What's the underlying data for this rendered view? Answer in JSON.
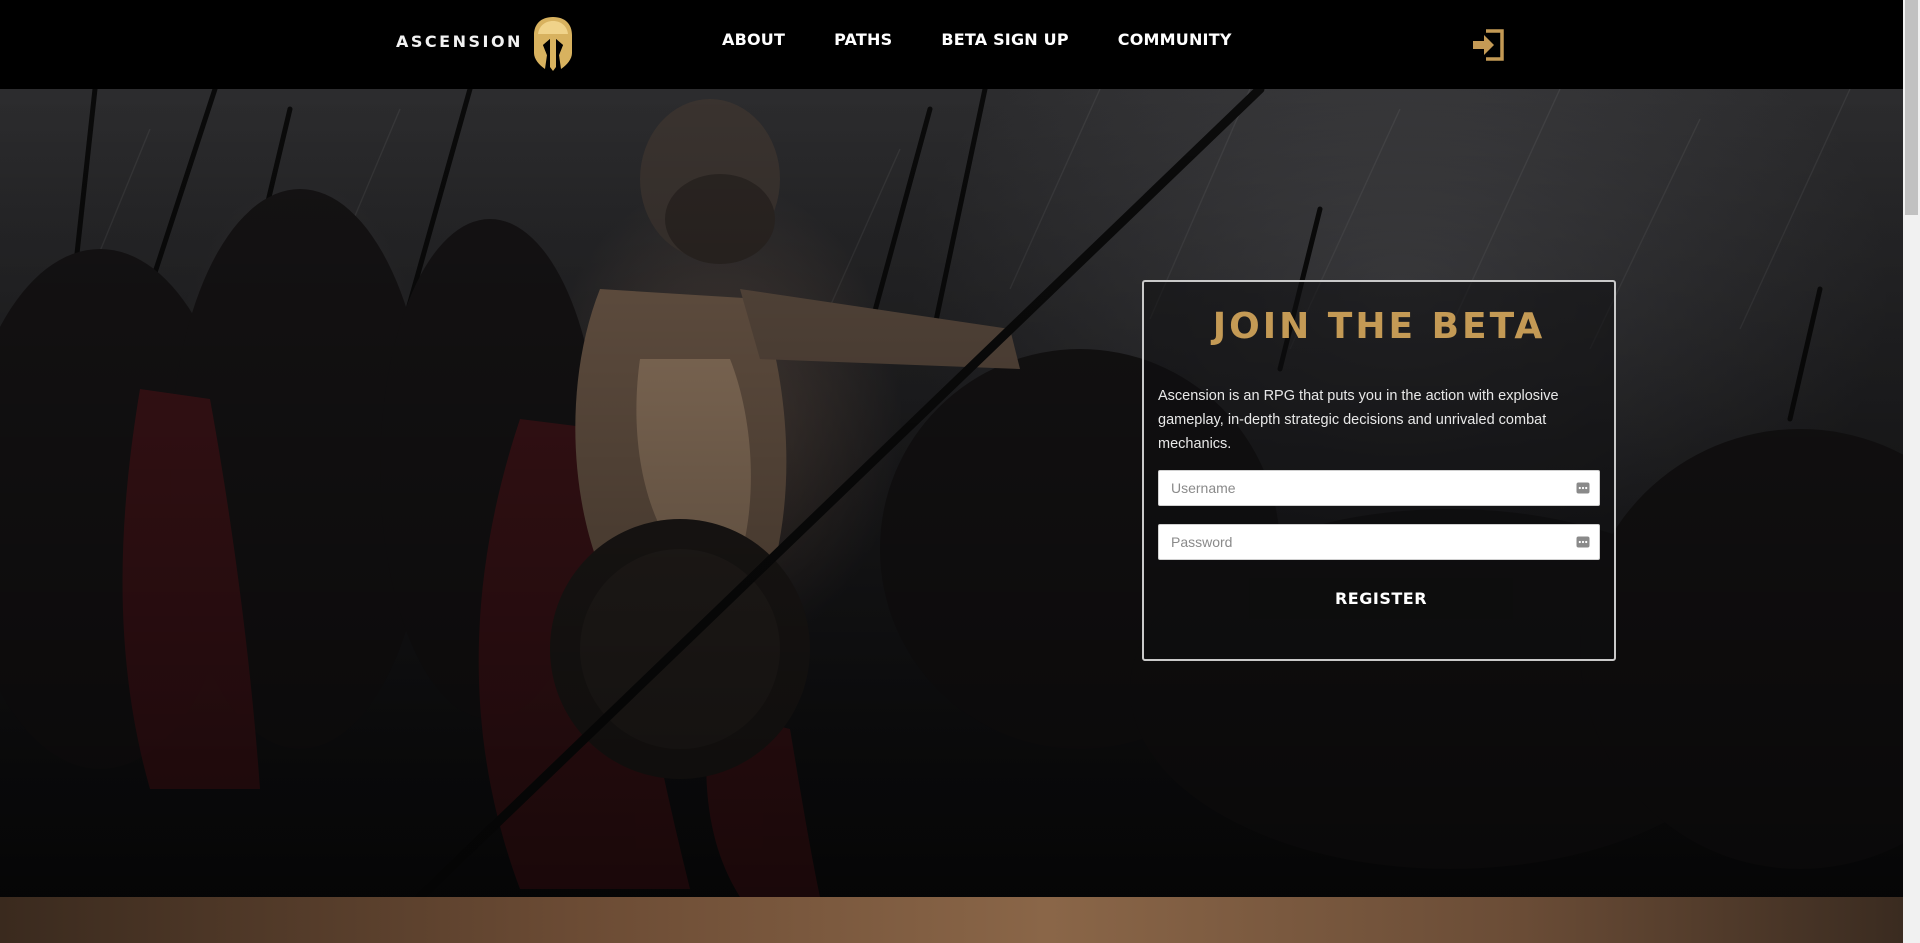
{
  "header": {
    "brand_name": "ASCENSION",
    "nav_items": [
      {
        "label": "ABOUT"
      },
      {
        "label": "PATHS"
      },
      {
        "label": "BETA SIGN UP"
      },
      {
        "label": "COMMUNITY"
      }
    ],
    "login_icon": "login-icon"
  },
  "beta_form": {
    "title": "JOIN THE BETA",
    "description": "Ascension is an RPG that puts you in the action with explosive gameplay, in-depth strategic decisions and unrivaled combat mechanics.",
    "username_placeholder": "Username",
    "password_placeholder": "Password",
    "username_value": "",
    "password_value": "",
    "register_label": "REGISTER"
  },
  "colors": {
    "accent_gold": "#c49a55",
    "nav_background": "#000000",
    "button_background": "#0d0d0d"
  }
}
